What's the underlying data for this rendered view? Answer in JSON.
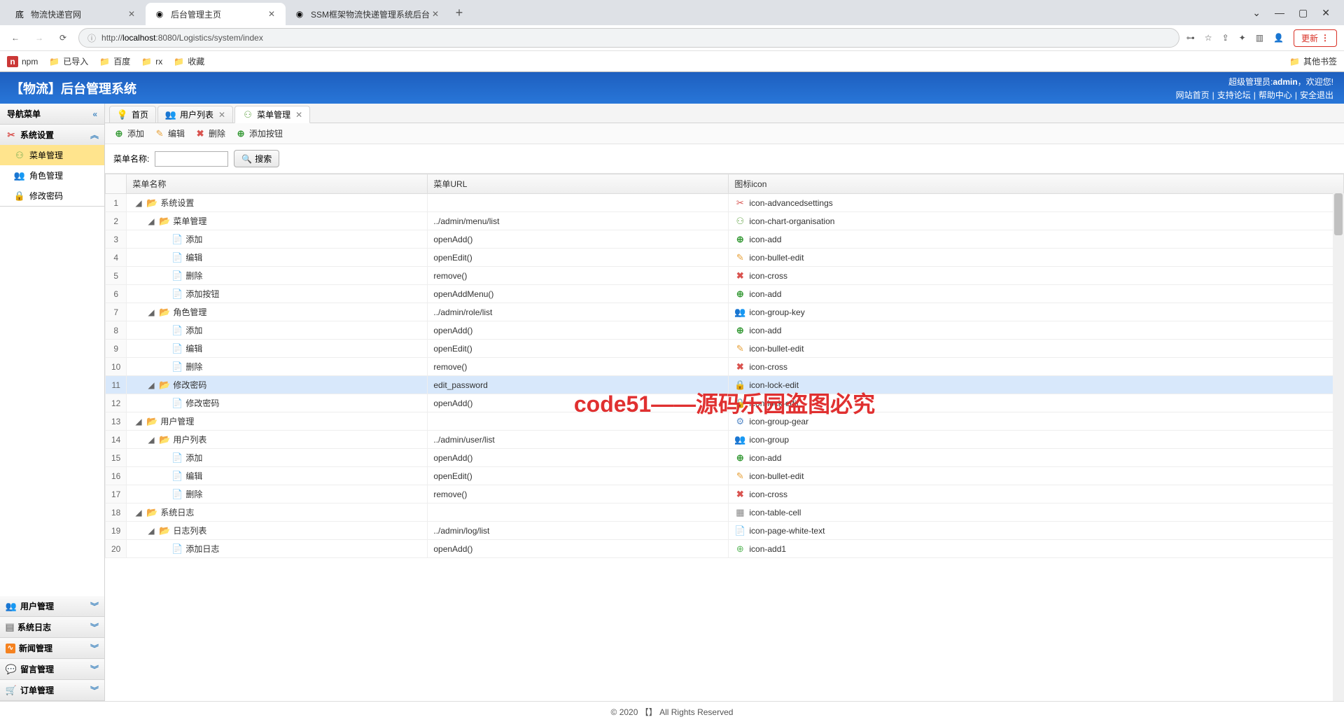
{
  "browser": {
    "tabs": [
      {
        "title": "物流快递官网",
        "active": false,
        "icon": "底"
      },
      {
        "title": "后台管理主页",
        "active": true,
        "icon": "◉"
      },
      {
        "title": "SSM框架物流快递管理系统后台",
        "active": false,
        "icon": "◉"
      }
    ],
    "url_prefix": "http://",
    "url_host": "localhost",
    "url_path": ":8080/Logistics/system/index",
    "update_label": "更新",
    "bookmarks": [
      {
        "label": "npm",
        "icon": "n",
        "icon_bg": "#cb3837"
      },
      {
        "label": "已导入",
        "icon": "folder"
      },
      {
        "label": "百度",
        "icon": "folder"
      },
      {
        "label": "rx",
        "icon": "folder"
      },
      {
        "label": "收藏",
        "icon": "folder"
      }
    ],
    "other_bookmarks": "其他书签"
  },
  "header": {
    "title": "【物流】后台管理系统",
    "welcome_prefix": "超级管理员:",
    "welcome_user": "admin",
    "welcome_suffix": "，欢迎您!",
    "links": [
      "网站首页",
      "支持论坛",
      "帮助中心",
      "安全退出"
    ]
  },
  "sidebar": {
    "title": "导航菜单",
    "panels": [
      {
        "label": "系统设置",
        "icon": "settings",
        "expanded": true,
        "items": [
          {
            "label": "菜单管理",
            "icon": "org",
            "active": true
          },
          {
            "label": "角色管理",
            "icon": "group",
            "active": false
          },
          {
            "label": "修改密码",
            "icon": "lock",
            "active": false
          }
        ]
      },
      {
        "label": "用户管理",
        "icon": "group",
        "expanded": false
      },
      {
        "label": "系统日志",
        "icon": "log",
        "expanded": false
      },
      {
        "label": "新闻管理",
        "icon": "rss",
        "expanded": false
      },
      {
        "label": "留言管理",
        "icon": "comment",
        "expanded": false
      },
      {
        "label": "订单管理",
        "icon": "cart",
        "expanded": false
      }
    ]
  },
  "content_tabs": [
    {
      "label": "首页",
      "icon": "bulb",
      "closable": false,
      "active": false
    },
    {
      "label": "用户列表",
      "icon": "group",
      "closable": true,
      "active": false
    },
    {
      "label": "菜单管理",
      "icon": "org",
      "closable": true,
      "active": true
    }
  ],
  "toolbar": {
    "add": "添加",
    "edit": "编辑",
    "delete": "删除",
    "add_button": "添加按钮"
  },
  "search": {
    "label": "菜单名称:",
    "value": "",
    "button": "搜索"
  },
  "table": {
    "columns": [
      "菜单名称",
      "菜单URL",
      "图标icon"
    ],
    "rows": [
      {
        "n": 1,
        "indent": 0,
        "exp": true,
        "icon": "folder",
        "name": "系统设置",
        "url": "",
        "iconName": "icon-advancedsettings",
        "iconType": "settings"
      },
      {
        "n": 2,
        "indent": 1,
        "exp": true,
        "icon": "folder",
        "name": "菜单管理",
        "url": "../admin/menu/list",
        "iconName": "icon-chart-organisation",
        "iconType": "org"
      },
      {
        "n": 3,
        "indent": 2,
        "exp": null,
        "icon": "file",
        "name": "添加",
        "url": "openAdd()",
        "iconName": "icon-add",
        "iconType": "add"
      },
      {
        "n": 4,
        "indent": 2,
        "exp": null,
        "icon": "file",
        "name": "编辑",
        "url": "openEdit()",
        "iconName": "icon-bullet-edit",
        "iconType": "edit"
      },
      {
        "n": 5,
        "indent": 2,
        "exp": null,
        "icon": "file",
        "name": "删除",
        "url": "remove()",
        "iconName": "icon-cross",
        "iconType": "cross"
      },
      {
        "n": 6,
        "indent": 2,
        "exp": null,
        "icon": "file",
        "name": "添加按钮",
        "url": "openAddMenu()",
        "iconName": "icon-add",
        "iconType": "add"
      },
      {
        "n": 7,
        "indent": 1,
        "exp": true,
        "icon": "folder",
        "name": "角色管理",
        "url": "../admin/role/list",
        "iconName": "icon-group-key",
        "iconType": "group"
      },
      {
        "n": 8,
        "indent": 2,
        "exp": null,
        "icon": "file",
        "name": "添加",
        "url": "openAdd()",
        "iconName": "icon-add",
        "iconType": "add"
      },
      {
        "n": 9,
        "indent": 2,
        "exp": null,
        "icon": "file",
        "name": "编辑",
        "url": "openEdit()",
        "iconName": "icon-bullet-edit",
        "iconType": "edit"
      },
      {
        "n": 10,
        "indent": 2,
        "exp": null,
        "icon": "file",
        "name": "删除",
        "url": "remove()",
        "iconName": "icon-cross",
        "iconType": "cross"
      },
      {
        "n": 11,
        "indent": 1,
        "exp": true,
        "icon": "folder",
        "name": "修改密码",
        "url": "edit_password",
        "iconName": "icon-lock-edit",
        "iconType": "lock",
        "selected": true
      },
      {
        "n": 12,
        "indent": 2,
        "exp": null,
        "icon": "file",
        "name": "修改密码",
        "url": "openAdd()",
        "iconName": "icon-lock-edit",
        "iconType": "lock"
      },
      {
        "n": 13,
        "indent": 0,
        "exp": true,
        "icon": "folder",
        "name": "用户管理",
        "url": "",
        "iconName": "icon-group-gear",
        "iconType": "gear"
      },
      {
        "n": 14,
        "indent": 1,
        "exp": true,
        "icon": "folder",
        "name": "用户列表",
        "url": "../admin/user/list",
        "iconName": "icon-group",
        "iconType": "group"
      },
      {
        "n": 15,
        "indent": 2,
        "exp": null,
        "icon": "file",
        "name": "添加",
        "url": "openAdd()",
        "iconName": "icon-add",
        "iconType": "add"
      },
      {
        "n": 16,
        "indent": 2,
        "exp": null,
        "icon": "file",
        "name": "编辑",
        "url": "openEdit()",
        "iconName": "icon-bullet-edit",
        "iconType": "edit"
      },
      {
        "n": 17,
        "indent": 2,
        "exp": null,
        "icon": "file",
        "name": "删除",
        "url": "remove()",
        "iconName": "icon-cross",
        "iconType": "cross"
      },
      {
        "n": 18,
        "indent": 0,
        "exp": true,
        "icon": "folder",
        "name": "系统日志",
        "url": "",
        "iconName": "icon-table-cell",
        "iconType": "table"
      },
      {
        "n": 19,
        "indent": 1,
        "exp": true,
        "icon": "folder",
        "name": "日志列表",
        "url": "../admin/log/list",
        "iconName": "icon-page-white-text",
        "iconType": "page"
      },
      {
        "n": 20,
        "indent": 2,
        "exp": null,
        "icon": "file",
        "name": "添加日志",
        "url": "openAdd()",
        "iconName": "icon-add1",
        "iconType": "add1"
      }
    ]
  },
  "watermark": "code51——源码乐园盗图必究",
  "footer": "© 2020 【】 All Rights Reserved"
}
